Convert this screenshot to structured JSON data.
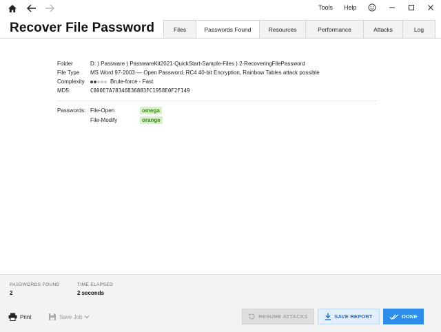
{
  "app": {
    "title": "Recover File Password"
  },
  "topbar": {
    "menu_tools": "Tools",
    "menu_help": "Help",
    "icons": [
      "home-icon",
      "back-arrow-icon",
      "forward-arrow-icon",
      "smiley-icon",
      "minimize-icon",
      "maximize-icon",
      "close-icon"
    ]
  },
  "tabs": [
    {
      "label": "Files",
      "active": false
    },
    {
      "label": "Passwords Found",
      "active": true
    },
    {
      "label": "Resources",
      "active": false
    },
    {
      "label": "Performance",
      "active": false
    },
    {
      "label": "Attacks",
      "active": false
    },
    {
      "label": "Log",
      "active": false
    }
  ],
  "file_info": {
    "folder_label": "Folder",
    "folder_value": "D: ) Passware ) PasswareKit2021-QuickStart-Sample-Files ) 2-RecoveringFilePassword",
    "filetype_label": "File Type",
    "filetype_value": "MS Word 97-2003 — Open Password, RC4 40-bit Encryption, Rainbow Tables attack possible",
    "complexity_label": "Complexity",
    "complexity_value": "Brute-force - Fast",
    "complexity_level": 2,
    "complexity_max": 5,
    "md5_label": "MD5:",
    "md5_value": "C800E7A78346B36883FC1958E0F2F149"
  },
  "passwords": {
    "label": "Passwords:",
    "items": [
      {
        "type": "File-Open",
        "value": "omega"
      },
      {
        "type": "File-Modify",
        "value": "orange"
      }
    ]
  },
  "footer": {
    "passwords_found_label": "PASSWORDS FOUND",
    "passwords_found_value": "2",
    "time_elapsed_label": "TIME ELAPSED",
    "time_elapsed_value": "2 seconds",
    "print_label": "Print",
    "save_job_label": "Save Job",
    "resume_label": "RESUME ATTACKS",
    "save_report_label": "SAVE REPORT",
    "done_label": "DONE"
  },
  "colors": {
    "accent": "#2e8ceb",
    "password_bg": "#d7f0c8",
    "password_text": "#3c8a1c"
  }
}
